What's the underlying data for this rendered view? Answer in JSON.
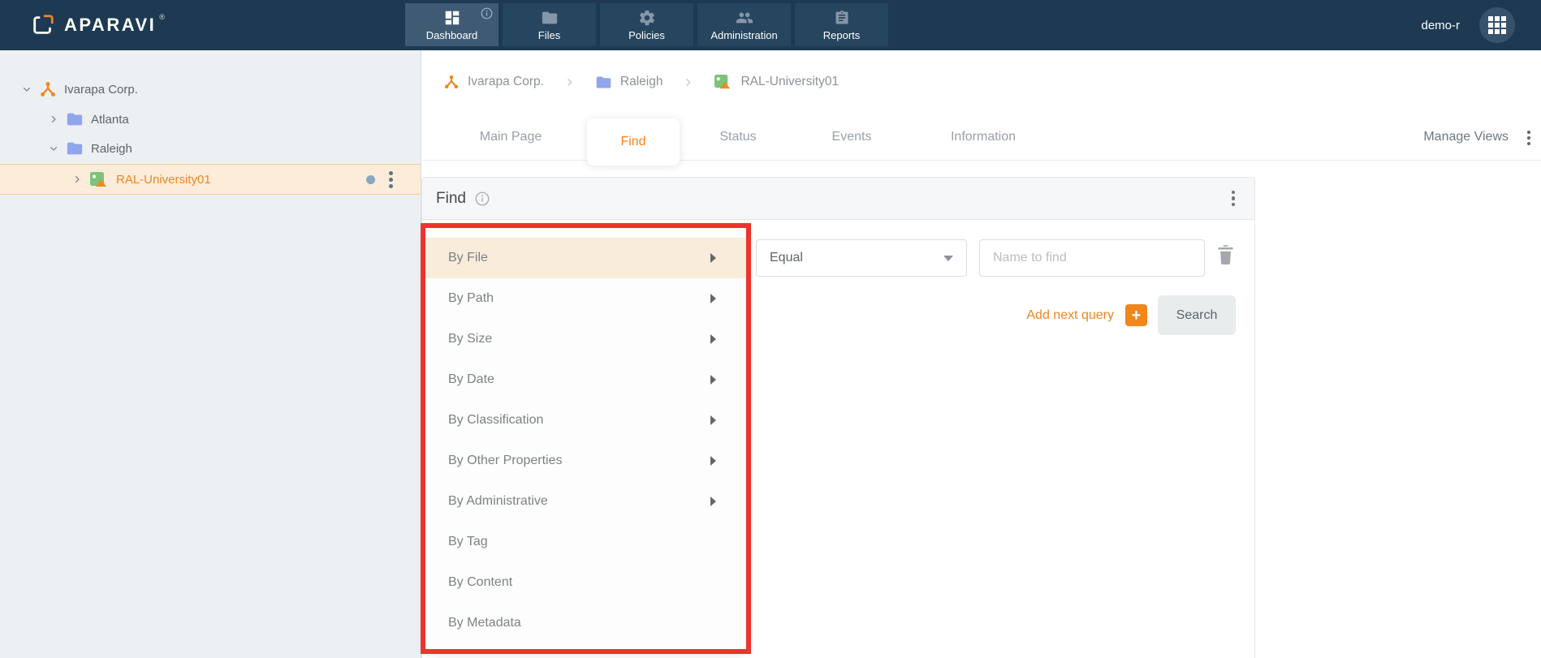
{
  "navbar": {
    "brand": "APARAVI",
    "brand_reg": "®",
    "user": "demo-r",
    "items": [
      {
        "label": "Dashboard",
        "icon": "dashboard-icon",
        "active": true,
        "has_info_badge": true
      },
      {
        "label": "Files",
        "icon": "folder-icon",
        "active": false
      },
      {
        "label": "Policies",
        "icon": "gear-icon",
        "active": false
      },
      {
        "label": "Administration",
        "icon": "people-icon",
        "active": false
      },
      {
        "label": "Reports",
        "icon": "clipboard-icon",
        "active": false
      }
    ]
  },
  "sidebar": {
    "tree": [
      {
        "label": "Ivarapa Corp.",
        "type": "company",
        "icon": "network-icon",
        "expanded": true,
        "level": 0,
        "selected": false
      },
      {
        "label": "Atlanta",
        "type": "folder",
        "icon": "folder-icon",
        "expanded": false,
        "level": 1,
        "selected": false
      },
      {
        "label": "Raleigh",
        "type": "folder",
        "icon": "folder-icon",
        "expanded": true,
        "level": 1,
        "selected": false
      },
      {
        "label": "RAL-University01",
        "type": "aggregator",
        "icon": "aggregator-icon",
        "expanded": false,
        "level": 2,
        "selected": true,
        "has_status_dot": true
      }
    ]
  },
  "breadcrumb": {
    "items": [
      {
        "label": "Ivarapa Corp.",
        "icon": "network-icon"
      },
      {
        "label": "Raleigh",
        "icon": "folder-icon"
      },
      {
        "label": "RAL-University01",
        "icon": "aggregator-icon"
      }
    ]
  },
  "tabs": {
    "items": [
      "Main Page",
      "Find",
      "Status",
      "Events",
      "Information"
    ],
    "active": "Find",
    "manage_views": "Manage Views"
  },
  "find_panel": {
    "title": "Find"
  },
  "query": {
    "operator": "Equal",
    "value": "",
    "placeholder": "Name to find",
    "add_next_label": "Add next query",
    "plus_label": "+",
    "search_label": "Search"
  },
  "menu": {
    "items": [
      {
        "label": "By File",
        "submenu": true,
        "highlighted": true
      },
      {
        "label": "By Path",
        "submenu": true,
        "highlighted": false
      },
      {
        "label": "By Size",
        "submenu": true,
        "highlighted": false
      },
      {
        "label": "By Date",
        "submenu": true,
        "highlighted": false
      },
      {
        "label": "By Classification",
        "submenu": true,
        "highlighted": false
      },
      {
        "label": "By Other Properties",
        "submenu": true,
        "highlighted": false
      },
      {
        "label": "By Administrative",
        "submenu": true,
        "highlighted": false
      },
      {
        "label": "By Tag",
        "submenu": false,
        "highlighted": false
      },
      {
        "label": "By Content",
        "submenu": false,
        "highlighted": false
      },
      {
        "label": "By Metadata",
        "submenu": false,
        "highlighted": false
      }
    ]
  },
  "colors": {
    "navbar_navy": "#1d3a52",
    "accent_orange": "#f0861c",
    "annotation_red": "#eb342b",
    "folder_blue": "#8fa5ee",
    "selected_peach": "#fcecd9",
    "aggregator_green": "#7cc47a"
  }
}
